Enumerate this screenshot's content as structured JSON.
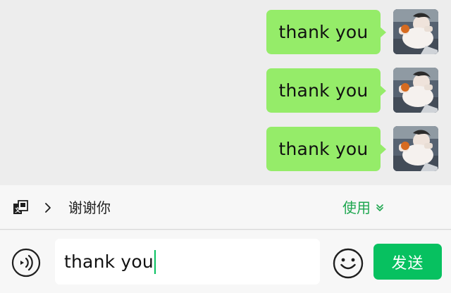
{
  "chat": {
    "messages": [
      {
        "text": "thank you",
        "sender": "self"
      },
      {
        "text": "thank you",
        "sender": "self"
      },
      {
        "text": "thank you",
        "sender": "self"
      }
    ]
  },
  "translation": {
    "icon": "translate-icon",
    "expand_icon": "chevron-right-icon",
    "text": "谢谢你",
    "use_label": "使用",
    "use_dropdown_icon": "chevron-down-icon"
  },
  "composer": {
    "voice_icon": "voice-icon",
    "input_value": "thank you",
    "emoji_icon": "smiley-icon",
    "send_label": "发送"
  },
  "colors": {
    "bubble": "#95ec69",
    "accent": "#07c160",
    "use_text": "#1fa750",
    "background": "#ededed"
  }
}
